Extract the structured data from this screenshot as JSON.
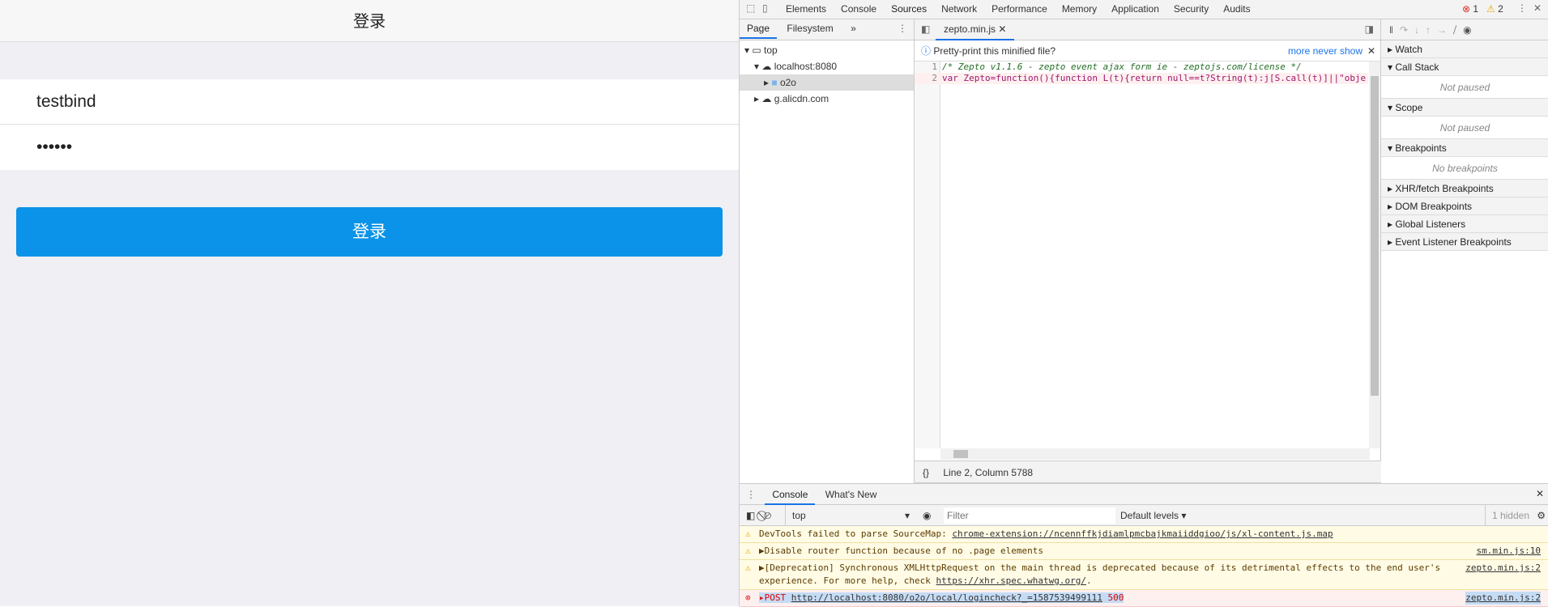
{
  "app": {
    "title": "登录",
    "username": "testbind",
    "password": "••••••",
    "login_button": "登录"
  },
  "devtools": {
    "tabs": [
      "Elements",
      "Console",
      "Sources",
      "Network",
      "Performance",
      "Memory",
      "Application",
      "Security",
      "Audits"
    ],
    "active_tab": "Sources",
    "errors": "1",
    "warnings": "2",
    "nav": {
      "tabs": [
        "Page",
        "Filesystem"
      ],
      "more": "»",
      "tree": [
        {
          "label": "top"
        },
        {
          "label": "localhost:8080"
        },
        {
          "label": "o2o"
        },
        {
          "label": "g.alicdn.com"
        }
      ]
    },
    "editor": {
      "file_tab": "zepto.min.js",
      "prompt": "Pretty-print this minified file?",
      "more": "more",
      "never_show": "never show",
      "lines": [
        {
          "n": "1",
          "code": "/* Zepto v1.1.6 - zepto event ajax form ie - zeptojs.com/license */"
        },
        {
          "n": "2",
          "code": "var Zepto=function(){function L(t){return null==t?String(t):j[S.call(t)]||\"obje"
        }
      ],
      "status": "Line 2, Column 5788",
      "format_icon": "{}"
    },
    "debugger": {
      "sections": [
        {
          "label": "Watch"
        },
        {
          "label": "Call Stack",
          "note": "Not paused"
        },
        {
          "label": "Scope",
          "note": "Not paused"
        },
        {
          "label": "Breakpoints",
          "note": "No breakpoints"
        },
        {
          "label": "XHR/fetch Breakpoints"
        },
        {
          "label": "DOM Breakpoints"
        },
        {
          "label": "Global Listeners"
        },
        {
          "label": "Event Listener Breakpoints"
        }
      ]
    },
    "drawer": {
      "tabs": [
        "Console",
        "What's New"
      ],
      "context": "top",
      "filter_placeholder": "Filter",
      "levels": "Default levels ▾",
      "hidden": "1 hidden",
      "messages": [
        {
          "level": "warning",
          "text": "DevTools failed to parse SourceMap: ",
          "link": "chrome-extension://ncennffkjdiamlpmcbajkmaiiddgioo/js/xl-content.js.map",
          "source": ""
        },
        {
          "level": "warning",
          "text": "▶Disable router function because of no .page elements",
          "source": "sm.min.js:10"
        },
        {
          "level": "warning",
          "text": "▶[Deprecation] Synchronous XMLHttpRequest on the main thread is deprecated because of its detrimental effects to the end user's",
          "text2": "experience. For more help, check ",
          "link": "https://xhr.spec.whatwg.org/",
          "source": "zepto.min.js:2"
        },
        {
          "level": "error",
          "method": "POST",
          "link": "http://localhost:8080/o2o/local/logincheck?_=1587539499111",
          "status": "500",
          "source": "zepto.min.js:2"
        }
      ]
    }
  }
}
